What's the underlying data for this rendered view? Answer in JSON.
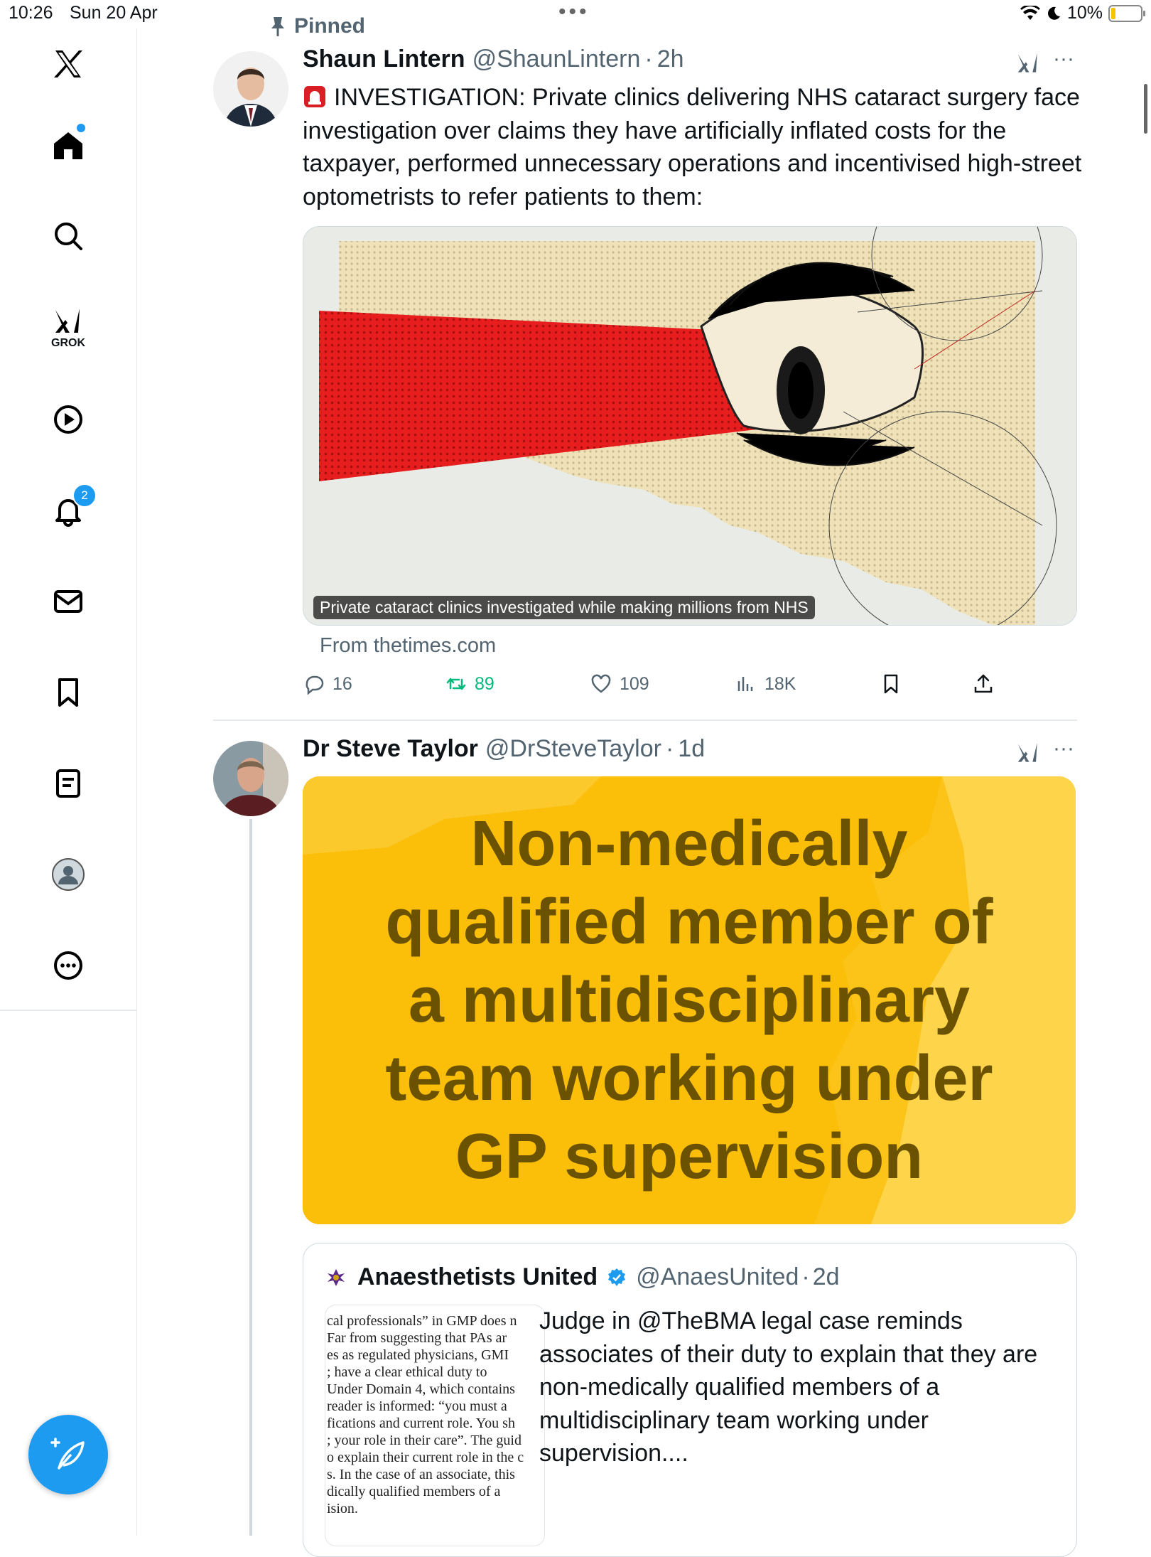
{
  "status_bar": {
    "time": "10:26",
    "date": "Sun 20 Apr",
    "battery": "10%"
  },
  "sidebar": {
    "grok_label": "GROK",
    "notifications_count": "2"
  },
  "tweet1": {
    "pinned_label": "Pinned",
    "name": "Shaun Lintern",
    "handle": "@ShaunLintern",
    "dot": "·",
    "time": "2h",
    "text": "INVESTIGATION: Private clinics delivering NHS cataract surgery face investigation over claims they have artificially inflated costs for the taxpayer, performed unnecessary operations and incentivised high-street optometrists to refer patients to them:",
    "card_caption": "Private cataract clinics investigated while making millions from NHS",
    "card_source": "From thetimes.com",
    "replies": "16",
    "reposts": "89",
    "likes": "109",
    "views": "18K",
    "more": "···"
  },
  "tweet2": {
    "name": "Dr Steve Taylor",
    "handle": "@DrSteveTaylor",
    "dot": "·",
    "time": "1d",
    "more": "···",
    "image_lines": [
      "Non-medically",
      "qualified member of",
      "a multidisciplinary",
      "team working under",
      "GP supervision"
    ],
    "quote": {
      "name": "Anaesthetists United",
      "handle": "@AnaesUnited",
      "dot": "·",
      "time": "2d",
      "text": "Judge in @TheBMA legal case reminds associates of their duty to explain that they are non-medically qualified members of a multidisciplinary team working under supervision....",
      "doc_lines": [
        "cal professionals” in GMP does n",
        "  Far from suggesting that PAs ar",
        "es as regulated physicians, GMI",
        "; have a clear ethical duty to",
        "Under Domain 4, which contains",
        " reader is informed: “you must a",
        "fications and current role. You sh",
        "; your role in their care”. The guid",
        "o explain their current role in the c",
        "s. In the case of an associate, this",
        "dically qualified members of a",
        "ision."
      ]
    }
  },
  "colors": {
    "accent": "#1d9bf0",
    "repost_green": "#00ba7c",
    "banner_yellow": "#fcc419",
    "banner_text": "#6b5200"
  }
}
